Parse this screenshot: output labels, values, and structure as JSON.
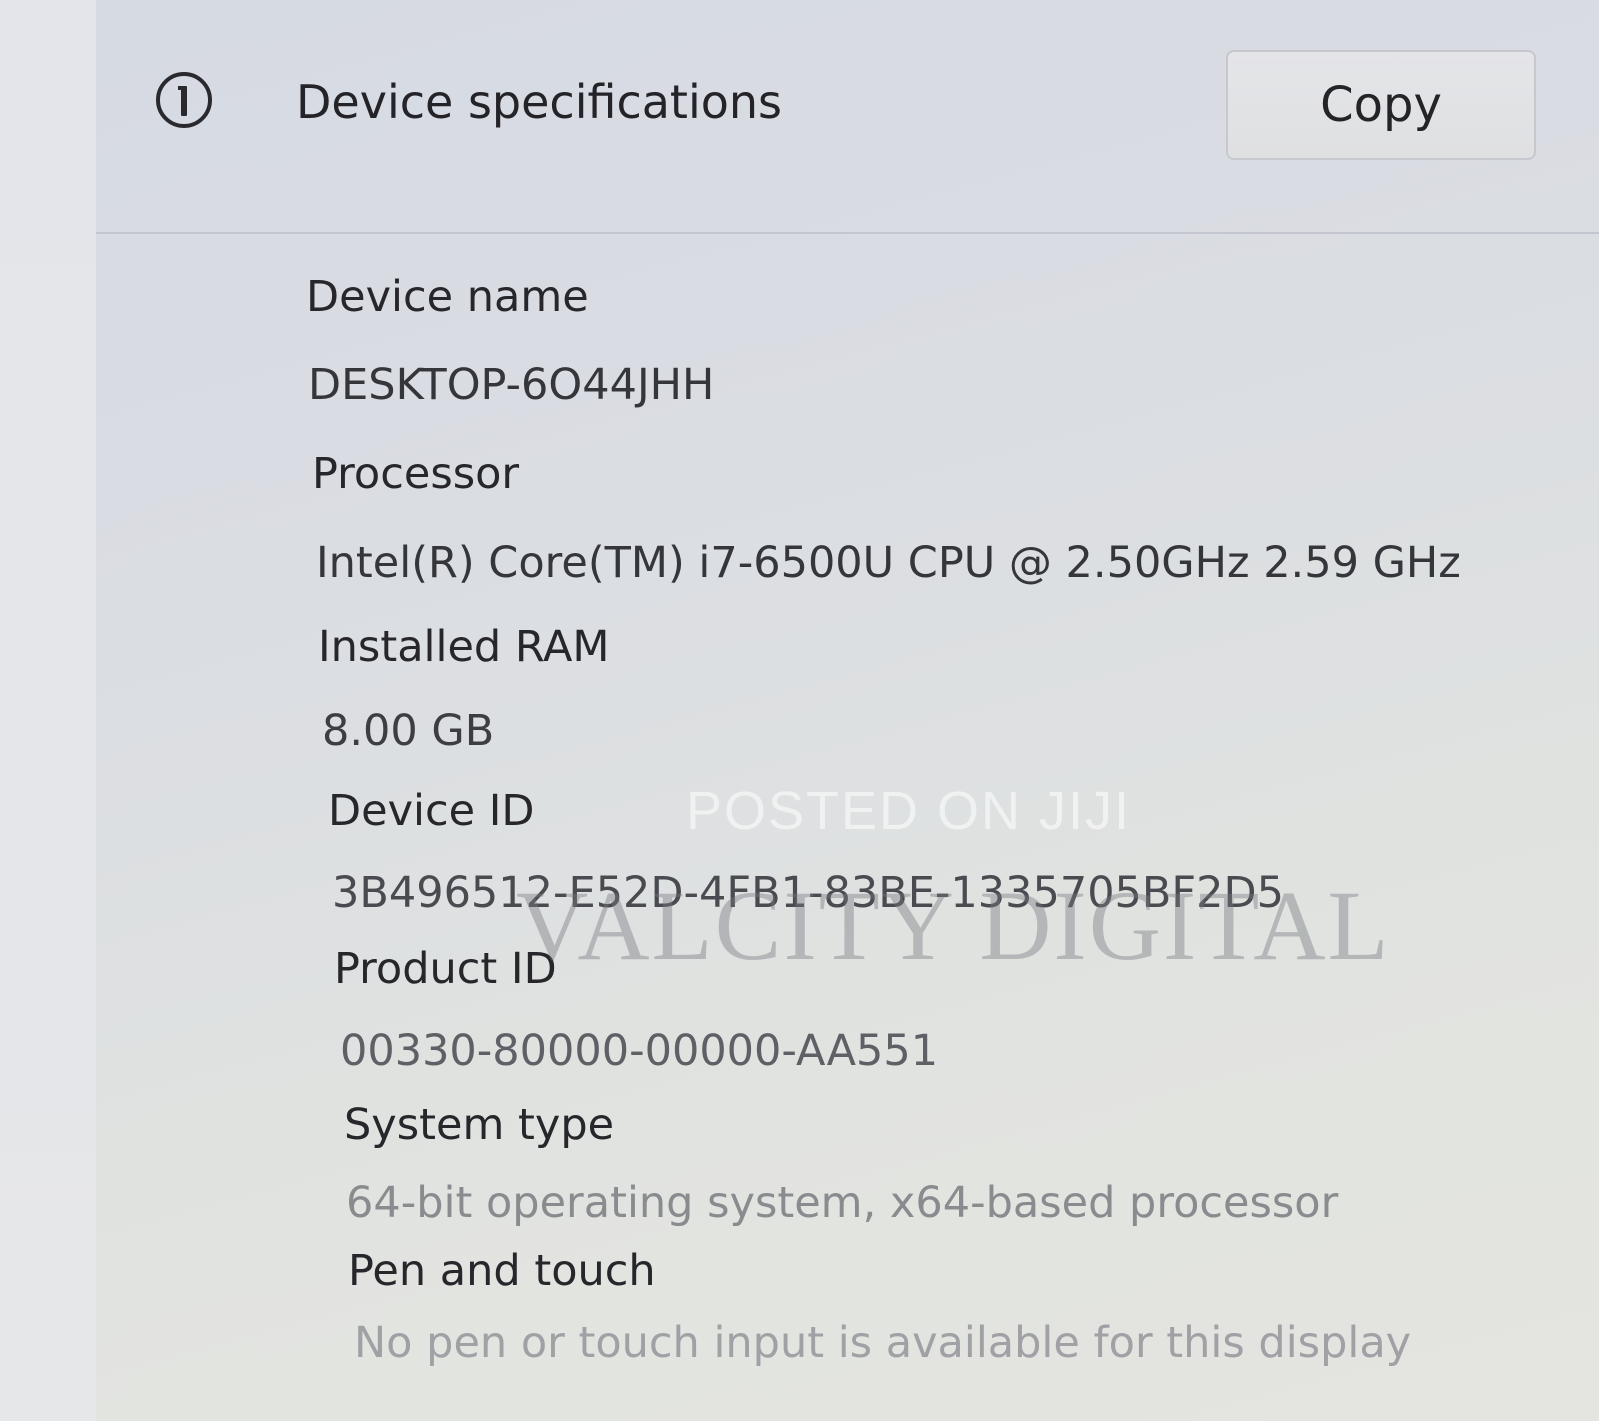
{
  "header": {
    "icon": "info-icon",
    "title": "Device specifications",
    "copy_label": "Copy"
  },
  "specs": [
    {
      "label": "Device name",
      "value": "DESKTOP-6O44JHH"
    },
    {
      "label": "Processor",
      "value": "Intel(R) Core(TM) i7-6500U CPU @ 2.50GHz   2.59 GHz"
    },
    {
      "label": "Installed RAM",
      "value": "8.00 GB"
    },
    {
      "label": "Device ID",
      "value": "3B496512-E52D-4FB1-83BE-1335705BF2D5"
    },
    {
      "label": "Product ID",
      "value": "00330-80000-00000-AA551"
    },
    {
      "label": "System type",
      "value": "64-bit operating system, x64-based processor"
    },
    {
      "label": "Pen and touch",
      "value": "No pen or touch input is available for this display"
    }
  ],
  "watermark": {
    "top": "POSTED ON JIJI",
    "main": "VALCITY DIGITAL"
  }
}
